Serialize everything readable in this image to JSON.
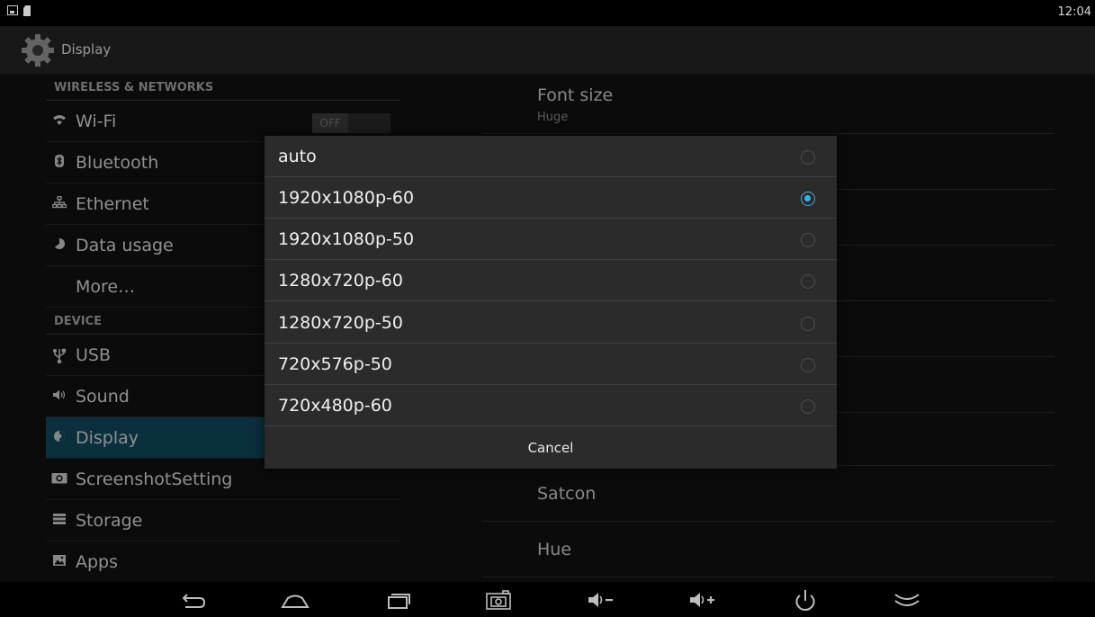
{
  "status_bar": {
    "clock": "12:04"
  },
  "action_bar": {
    "title": "Display"
  },
  "left_pane": {
    "sections": [
      {
        "header": "WIRELESS & NETWORKS",
        "items": [
          {
            "label": "Wi-Fi",
            "icon": "wifi-icon",
            "toggle": "OFF"
          },
          {
            "label": "Bluetooth",
            "icon": "bluetooth-icon"
          },
          {
            "label": "Ethernet",
            "icon": "ethernet-icon"
          },
          {
            "label": "Data usage",
            "icon": "data-usage-icon"
          },
          {
            "label": "More…",
            "icon": ""
          }
        ]
      },
      {
        "header": "DEVICE",
        "items": [
          {
            "label": "USB",
            "icon": "usb-icon"
          },
          {
            "label": "Sound",
            "icon": "sound-icon"
          },
          {
            "label": "Display",
            "icon": "display-icon",
            "selected": true
          },
          {
            "label": "ScreenshotSetting",
            "icon": "camera-icon"
          },
          {
            "label": "Storage",
            "icon": "storage-icon"
          },
          {
            "label": "Apps",
            "icon": "apps-icon"
          }
        ]
      }
    ]
  },
  "right_pane": {
    "font_size": {
      "title": "Font size",
      "summary": "Huge"
    },
    "satcon": {
      "title": "Satcon"
    },
    "hue": {
      "title": "Hue"
    }
  },
  "dialog": {
    "options": [
      {
        "label": "auto",
        "checked": false
      },
      {
        "label": "1920x1080p-60",
        "checked": true
      },
      {
        "label": "1920x1080p-50",
        "checked": false
      },
      {
        "label": "1280x720p-60",
        "checked": false
      },
      {
        "label": "1280x720p-50",
        "checked": false
      },
      {
        "label": "720x576p-50",
        "checked": false
      },
      {
        "label": "720x480p-60",
        "checked": false
      }
    ],
    "cancel_label": "Cancel"
  },
  "nav_bar": {
    "buttons": [
      "back-icon",
      "home-icon",
      "recent-apps-icon",
      "screenshot-icon",
      "volume-down-icon",
      "volume-up-icon",
      "power-icon",
      "hide-bar-icon"
    ]
  },
  "colors": {
    "accent": "#33b5e5",
    "selected_row": "#124b5e",
    "dialog_bg": "#2b2b2b"
  }
}
